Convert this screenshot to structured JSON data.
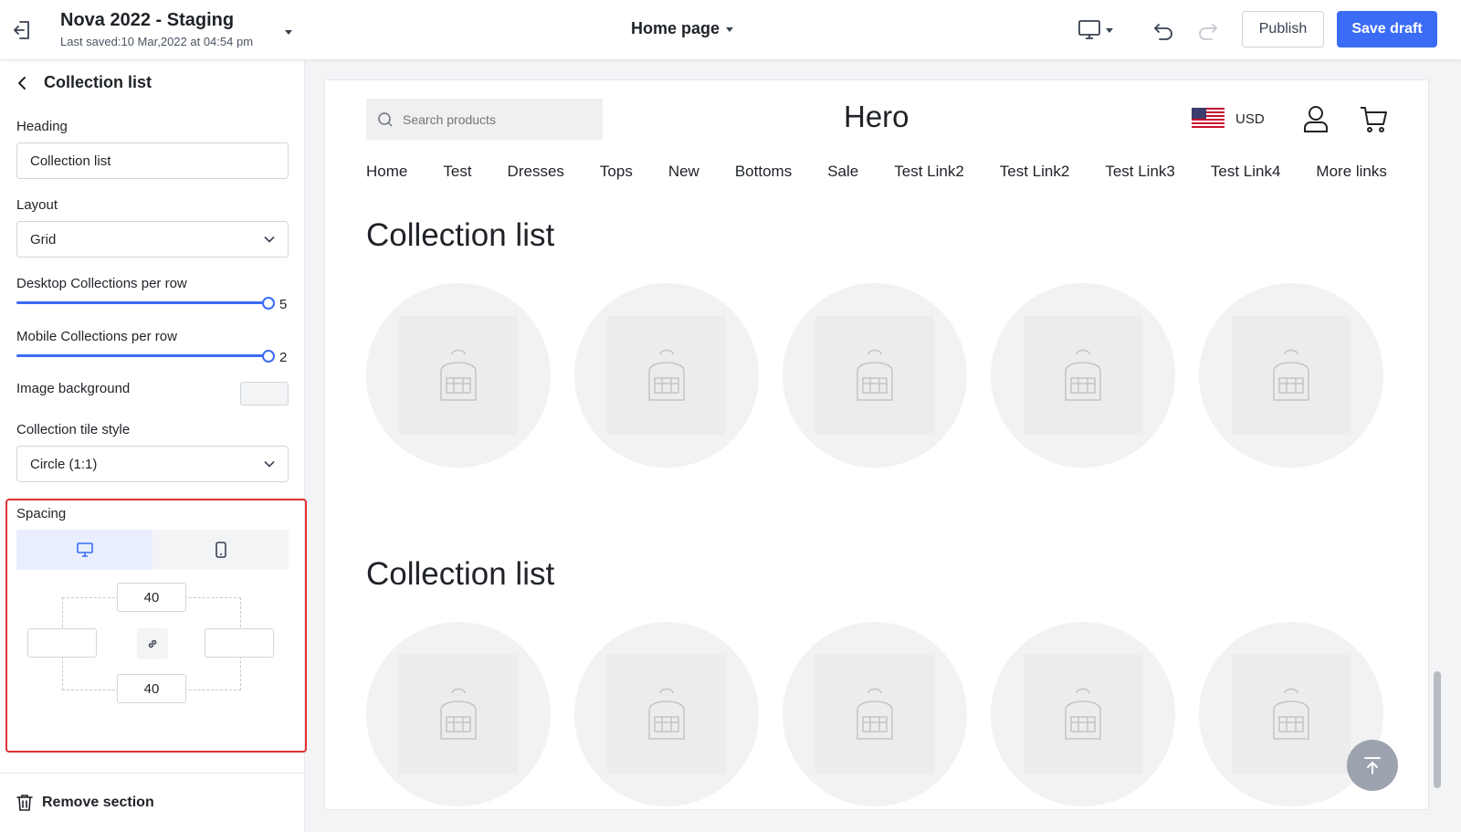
{
  "header": {
    "site_title": "Nova 2022 - Staging",
    "last_saved": "Last saved:10 Mar,2022 at 04:54 pm",
    "page_selector": "Home page",
    "publish_label": "Publish",
    "save_label": "Save draft",
    "icons": [
      "exit-icon",
      "chevron-down-icon",
      "desktop-icon",
      "undo-icon",
      "redo-icon"
    ]
  },
  "sidebar": {
    "title": "Collection list",
    "heading_label": "Heading",
    "heading_value": "Collection list",
    "layout_label": "Layout",
    "layout_value": "Grid",
    "desktop_per_row_label": "Desktop Collections per row",
    "desktop_per_row_value": "5",
    "mobile_per_row_label": "Mobile Collections per row",
    "mobile_per_row_value": "2",
    "image_bg_label": "Image background",
    "tile_style_label": "Collection tile style",
    "tile_style_value": "Circle (1:1)",
    "spacing": {
      "label": "Spacing",
      "active_tab": "desktop",
      "top": "40",
      "bottom": "40",
      "left": "",
      "right": ""
    },
    "remove_label": "Remove section"
  },
  "store": {
    "search_placeholder": "Search products",
    "name": "Hero",
    "currency": "USD",
    "nav": [
      "Home",
      "Test",
      "Dresses",
      "Tops",
      "New",
      "Bottoms",
      "Sale",
      "Test Link2",
      "Test Link2",
      "Test Link3",
      "Test Link4",
      "More links"
    ],
    "sections": [
      {
        "title": "Collection list",
        "tile_count": 5
      },
      {
        "title": "Collection list",
        "tile_count": 5
      }
    ]
  },
  "colors": {
    "accent": "#3b6cf6",
    "highlight_border": "#e03131"
  }
}
